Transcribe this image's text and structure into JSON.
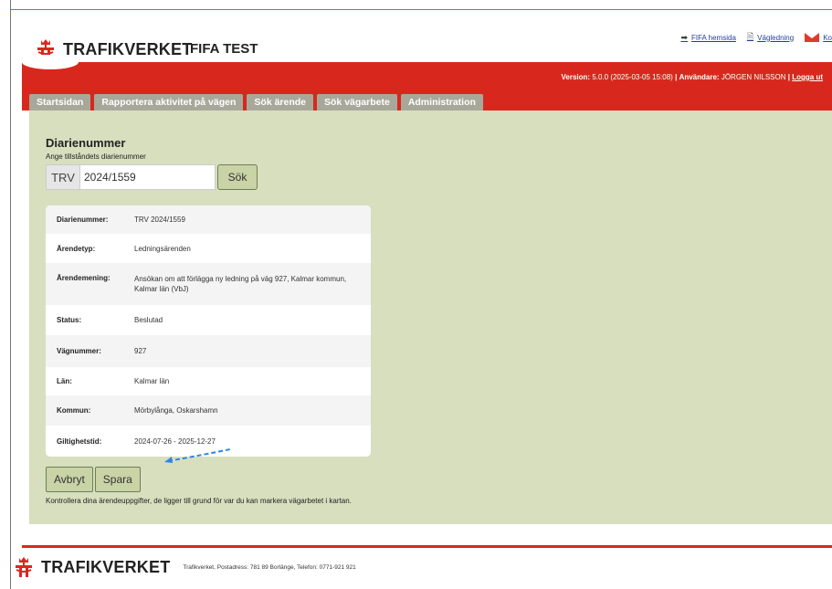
{
  "header": {
    "brand": "TRAFIKVERKET",
    "app_title": "FIFA TEST",
    "links": [
      {
        "label": "FIFA hemsida",
        "icon": "arrow-right-icon"
      },
      {
        "label": "Vägledning",
        "icon": "document-icon"
      },
      {
        "label": "Ko",
        "icon": "mail-icon"
      }
    ],
    "version_label": "Version:",
    "version_value": "5.0.0 (2025-03-05 15:08)",
    "separator": "|",
    "user_label": "Användare:",
    "user_value": "JÖRGEN NILSSON",
    "logout": "Logga ut",
    "brand_color": "#d8281e"
  },
  "tabs": [
    {
      "label": "Startsidan"
    },
    {
      "label": "Rapportera aktivitet på vägen"
    },
    {
      "label": "Sök ärende"
    },
    {
      "label": "Sök vägarbete"
    },
    {
      "label": "Administration"
    }
  ],
  "search": {
    "heading": "Diarienummer",
    "label": "Ange tillståndets diarienummer",
    "prefix": "TRV",
    "value": "2024/1559",
    "button": "Sök"
  },
  "details": [
    {
      "key": "Diarienummer:",
      "value": "TRV 2024/1559"
    },
    {
      "key": "Ärendetyp:",
      "value": "Ledningsärenden"
    },
    {
      "key": "Ärendemening:",
      "value": "Ansökan om att förlägga ny ledning på väg 927, Kalmar kommun, Kalmar län (VbJ)"
    },
    {
      "key": "Status:",
      "value": "Beslutad"
    },
    {
      "key": "Vägnummer:",
      "value": "927"
    },
    {
      "key": "Län:",
      "value": "Kalmar län"
    },
    {
      "key": "Kommun:",
      "value": "Mörbylånga, Oskarshamn"
    },
    {
      "key": "Giltighetstid:",
      "value": "2024-07-26 - 2025-12-27"
    }
  ],
  "actions": {
    "cancel": "Avbryt",
    "save": "Spara"
  },
  "hint": "Kontrollera dina ärendeuppgifter, de ligger till grund för var du kan markera vägarbetet i kartan.",
  "footer": {
    "brand": "TRAFIKVERKET",
    "info": "Trafikverket, Postadress: 781 89 Borlänge, Telefon: 0771-921 921"
  }
}
